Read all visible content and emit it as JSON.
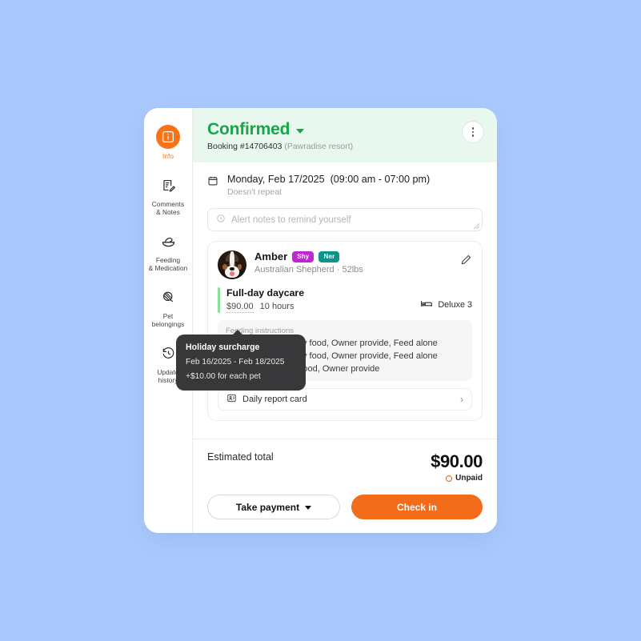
{
  "background_color": "#aac9fd",
  "sidebar": {
    "items": [
      {
        "id": "info",
        "label": "Info",
        "icon": "info-square-icon",
        "active": true
      },
      {
        "id": "comments",
        "label": "Comments\n& Notes",
        "label_line1": "Comments",
        "label_line2": "& Notes",
        "icon": "notes-edit-icon",
        "active": false
      },
      {
        "id": "feeding",
        "label": "Feeding\n& Medication",
        "label_line1": "Feeding",
        "label_line2": "& Medication",
        "icon": "food-bowl-icon",
        "active": false
      },
      {
        "id": "belongings",
        "label": "Pet\nbelongings",
        "label_line1": "Pet",
        "label_line2": "belongings",
        "icon": "yarn-ball-icon",
        "active": false
      },
      {
        "id": "history",
        "label": "Update\nhistory",
        "label_line1": "Update",
        "label_line2": "history",
        "icon": "history-clock-icon",
        "active": false
      }
    ],
    "active_color": "#f97316"
  },
  "header": {
    "status": "Confirmed",
    "status_color": "#17a64a",
    "status_bg": "#e8f8ee",
    "booking_label": "Booking #14706403",
    "resort": "(Pawradise resort)",
    "menu_icon": "kebab-menu-icon"
  },
  "schedule": {
    "calendar_icon": "calendar-icon",
    "date": "Monday, Feb 17/2025",
    "time": "(09:00 am - 07:00 pm)",
    "repeat": "Doesn't repeat"
  },
  "alert_notes": {
    "icon": "alert-clock-icon",
    "placeholder": "Alert notes to remind yourself",
    "value": ""
  },
  "pet": {
    "avatar_icon": "dog-avatar",
    "name": "Amber",
    "tags": [
      {
        "label": "Shy",
        "color": "#c026d3"
      },
      {
        "label": "Ner",
        "color": "#0d9488"
      }
    ],
    "breed_weight": "Australian Shepherd · 52lbs",
    "edit_icon": "pencil-edit-icon",
    "service": {
      "title": "Full-day daycare",
      "price": "$90.00",
      "duration": "10 hours",
      "accent_color": "#86e29b"
    },
    "room": {
      "icon": "bed-icon",
      "label": "Deluxe 3"
    },
    "feeding": {
      "heading": "Feeding instructions",
      "lines": [
        "Morning: 1.5 Oz, Dry food, Owner provide, Feed alone",
        "Evening: 1.5 Oz, Dry food, Owner provide, Feed alone",
        "Noon: 1.5 Oz, Wet food, Owner provide"
      ]
    },
    "report_card": {
      "icon": "report-card-icon",
      "label": "Daily report card",
      "chevron": "›"
    }
  },
  "tooltip": {
    "title": "Holiday surcharge",
    "date_range": "Feb 16/2025 - Feb 18/2025",
    "amount": "+$10.00 for each pet"
  },
  "footer": {
    "total_label": "Estimated total",
    "total_amount": "$90.00",
    "payment_status": "Unpaid",
    "payment_status_color": "#f05a28",
    "secondary_button": "Take payment",
    "primary_button": "Check in",
    "primary_color": "#f26c1a"
  }
}
